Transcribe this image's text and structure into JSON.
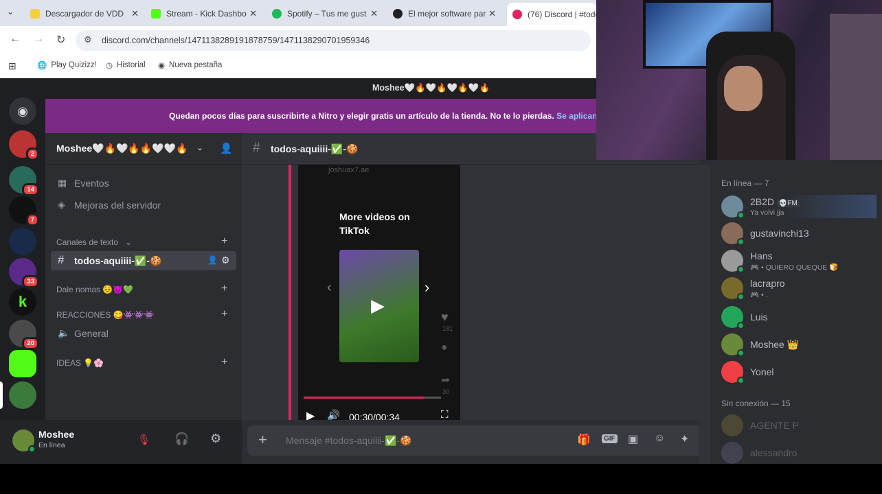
{
  "browser": {
    "tabs": [
      {
        "title": "Descargador de VDD",
        "color": "#f4d03f"
      },
      {
        "title": "Stream - Kick Dashbo",
        "color": "#53fc18"
      },
      {
        "title": "Spotify – Tus me gust",
        "color": "#1db954"
      },
      {
        "title": "El mejor software par",
        "color": "#202020"
      },
      {
        "title": "(76) Discord | #todo",
        "color": "#e0245e"
      }
    ],
    "url": "discord.com/channels/1471138289191878759/1471138290701959346",
    "bookmarks": [
      "Play Quizizz!",
      "Historial",
      "Nueva pestaña"
    ]
  },
  "discord": {
    "window_title": "Moshee🤍🔥🤍🔥🤍🔥🤍🔥",
    "nitro_banner": "Quedan pocos días para suscribirte a Nitro y elegir gratis un artículo de la tienda. No te lo pierdas.",
    "nitro_link": "Se aplican C",
    "server_name": "Moshee🤍🔥🤍🔥🔥🤍🤍🔥",
    "sidebar": {
      "events": "Eventos",
      "boosts": "Mejoras del servidor",
      "text_category": "Canales de texto",
      "active_channel": "todos-aquiiii-✅-🍪",
      "cat_dale": "Dale nomas 😣👿💚",
      "cat_reacciones": "REACCIONES 😋👾👾👾",
      "voice_general": "General",
      "cat_ideas": "IDEAS 💡🌸"
    },
    "channel_header": "todos-aquiiii-✅-🍪",
    "video": {
      "watermark": "joshuax7.ae",
      "more_videos": "More videos on TikTok",
      "likes": "181",
      "time": "00:30/00:34",
      "side_count": "30",
      "progress": 0.88
    },
    "message_placeholder": "Mensaje #todos-aquiiii-✅-🍪",
    "user": {
      "name": "Moshee",
      "status": "En línea",
      "badge": "2"
    },
    "members": {
      "online_header": "En línea — 7",
      "online": [
        {
          "name": "2B2D",
          "status": "Ya volvi jja",
          "tag": "💀FM",
          "color": "#6d8b9a"
        },
        {
          "name": "gustavinchi13",
          "status": "",
          "color": "#8a6a58"
        },
        {
          "name": "Hans",
          "status": "🎮 • QUIERO QUEQUE 🍞",
          "color": "#9a9a9a"
        },
        {
          "name": "lacrapro",
          "status": "🎮 • .",
          "color": "#7a6a2a"
        },
        {
          "name": "Luis",
          "status": "",
          "color": "#23a55a"
        },
        {
          "name": "Moshee 👑",
          "status": "",
          "color": "#6a8a3a"
        },
        {
          "name": "Yonel",
          "status": "",
          "color": "#f23f43"
        }
      ],
      "offline_header": "Sin conexión — 15",
      "offline": [
        {
          "name": "AGENTE P",
          "color": "#8a7a3a"
        },
        {
          "name": "alessandro",
          "color": "#6a6a8a"
        }
      ]
    },
    "guild_badges": [
      "2",
      "14",
      "7",
      "33",
      "20"
    ]
  }
}
